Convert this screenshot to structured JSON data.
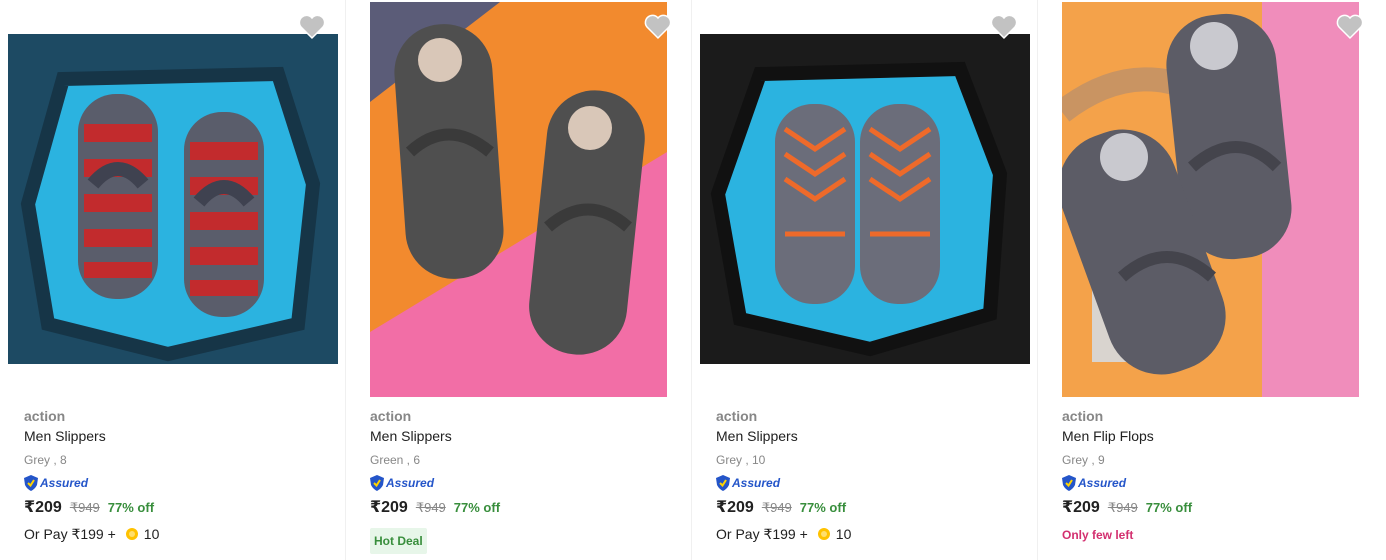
{
  "colors": {
    "wishlist_heart": "#c2c2c2",
    "off_green": "#388e3c",
    "assured_blue": "#2455c9",
    "few_left": "#d32f6f"
  },
  "products": [
    {
      "brand": "action",
      "title": "Men Slippers",
      "variant": "Grey , 8",
      "assured_label": "Assured",
      "price": "₹209",
      "mrp": "₹949",
      "discount": "77% off",
      "pay_label": "Or Pay ₹199 +",
      "coins": "10",
      "wishlist_icon": "heart-icon"
    },
    {
      "brand": "action",
      "title": "Men Slippers",
      "variant": "Green , 6",
      "assured_label": "Assured",
      "price": "₹209",
      "mrp": "₹949",
      "discount": "77% off",
      "badge": "Hot Deal",
      "wishlist_icon": "heart-icon"
    },
    {
      "brand": "action",
      "title": "Men Slippers",
      "variant": "Grey , 10",
      "assured_label": "Assured",
      "price": "₹209",
      "mrp": "₹949",
      "discount": "77% off",
      "pay_label": "Or Pay ₹199 +",
      "coins": "10",
      "wishlist_icon": "heart-icon"
    },
    {
      "brand": "action",
      "title": "Men Flip Flops",
      "variant": "Grey , 9",
      "assured_label": "Assured",
      "price": "₹209",
      "mrp": "₹949",
      "discount": "77% off",
      "stock_note": "Only few left",
      "wishlist_icon": "heart-icon"
    }
  ]
}
